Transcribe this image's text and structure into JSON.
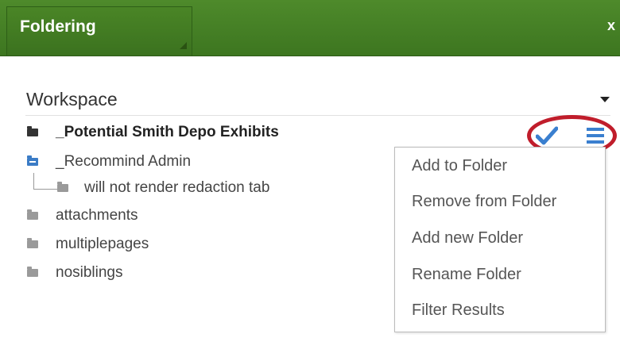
{
  "panel": {
    "title": "Foldering",
    "close_label": "x"
  },
  "workspace": {
    "selected": "Workspace"
  },
  "tree": [
    {
      "label": "_Potential Smith Depo Exhibits",
      "icon": "folder-dark-icon"
    },
    {
      "label": "_Recommind Admin",
      "icon": "folder-blue-open-icon"
    },
    {
      "label": "will not render redaction tab",
      "icon": "folder-grey-icon"
    },
    {
      "label": "attachments",
      "icon": "folder-grey-icon"
    },
    {
      "label": "multiplepages",
      "icon": "folder-grey-icon"
    },
    {
      "label": "nosiblings",
      "icon": "folder-grey-icon"
    }
  ],
  "actions_menu": {
    "items": [
      {
        "label": "Add to Folder"
      },
      {
        "label": "Remove from Folder"
      },
      {
        "label": "Add new Folder"
      },
      {
        "label": "Rename Folder"
      },
      {
        "label": "Filter Results"
      }
    ]
  },
  "colors": {
    "header_green": "#4e8a2b",
    "accent_blue": "#3a7fcf",
    "highlight_red": "#c01d2b"
  }
}
